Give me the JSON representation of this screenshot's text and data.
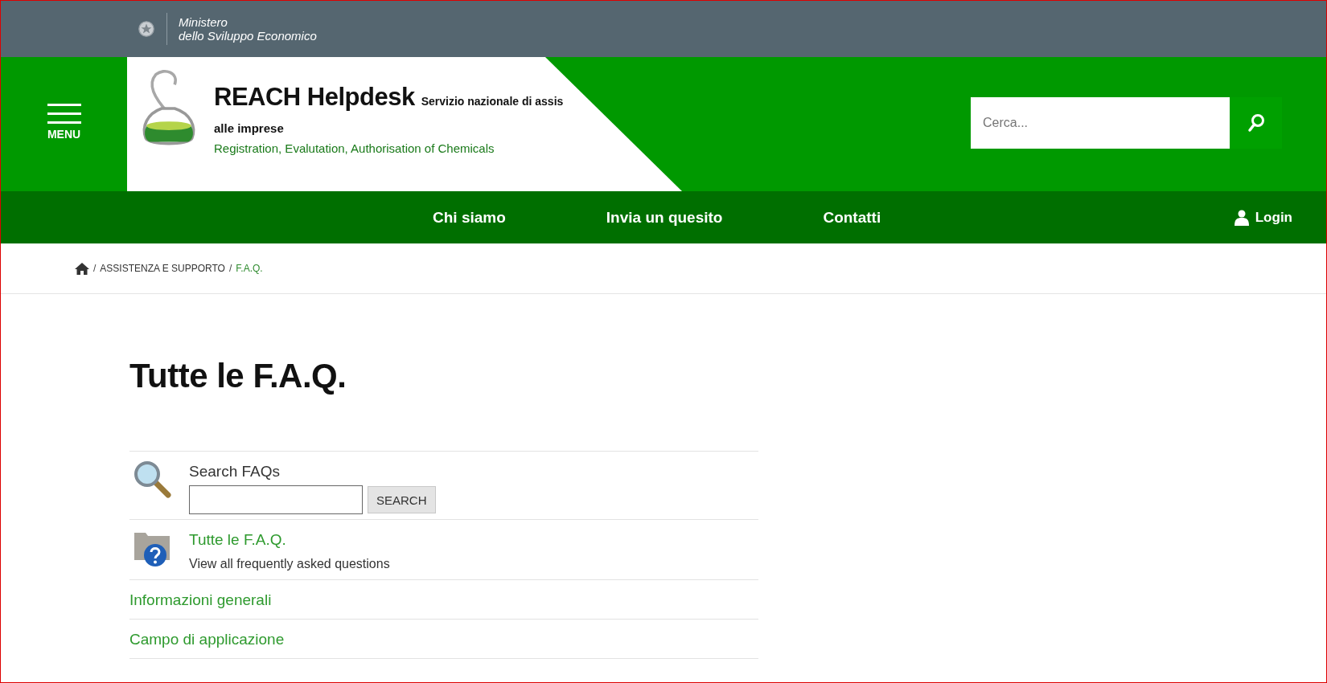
{
  "top_bar": {
    "ministry_line_1": "Ministero",
    "ministry_line_2": "dello Sviluppo Economico"
  },
  "header": {
    "menu_label": "MENU",
    "site_title": "REACH Helpdesk",
    "site_subtitle": "Servizio nazionale di assis",
    "subtitle_continued": "alle imprese",
    "tagline": "Registration, Evalutation, Authorisation of Chemicals",
    "search": {
      "placeholder": "Cerca..."
    }
  },
  "nav": {
    "items": [
      {
        "label": "Chi siamo"
      },
      {
        "label": "Invia un quesito"
      },
      {
        "label": "Contatti"
      }
    ],
    "login": "Login"
  },
  "breadcrumb": {
    "items": [
      {
        "label": "ASSISTENZA E SUPPORTO",
        "current": false
      },
      {
        "label": "F.A.Q.",
        "current": true
      }
    ],
    "separator": "/"
  },
  "page_title": "Tutte le F.A.Q.",
  "faq": {
    "search_title": "Search FAQs",
    "search_button": "SEARCH",
    "all": {
      "title": "Tutte le F.A.Q.",
      "description": "View all frequently asked questions"
    },
    "categories": [
      {
        "label": "Informazioni generali"
      },
      {
        "label": "Campo di applicazione"
      }
    ]
  }
}
